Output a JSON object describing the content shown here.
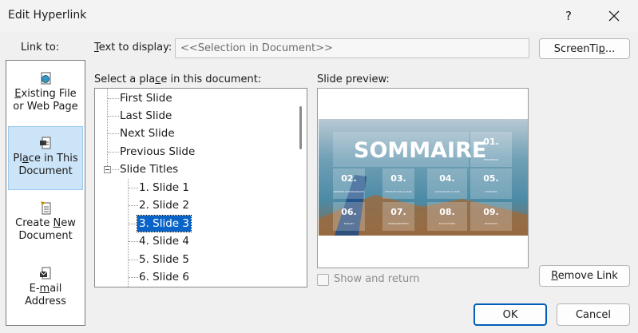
{
  "window": {
    "title": "Edit Hyperlink",
    "help_label": "?"
  },
  "link_to": {
    "label": "Link to:",
    "items": [
      {
        "label_a": "E",
        "label_b": "xisting File",
        "label_c": "or Web Page",
        "icon": "web-page-icon"
      },
      {
        "label_a": "Pl",
        "label_b": "a",
        "label_c": "ce in This",
        "label_d": "Document",
        "icon": "place-in-document-icon"
      },
      {
        "label_a": "Create ",
        "label_b": "N",
        "label_c": "ew",
        "label_d": "Document",
        "icon": "new-document-icon"
      },
      {
        "label_a": "E-",
        "label_b": "m",
        "label_c": "ail",
        "label_d": "Address",
        "icon": "email-address-icon"
      }
    ]
  },
  "text_to_display": {
    "label_u": "T",
    "label_rest": "ext to display:",
    "value": "<<Selection in Document>>"
  },
  "screentip_button": {
    "label_a": "ScreenTi",
    "label_b": "p",
    "label_c": "..."
  },
  "place_section": {
    "label_a": "Select a pla",
    "label_b": "c",
    "label_c": "e in this document:",
    "tree": [
      {
        "label": "First Slide"
      },
      {
        "label": "Last Slide"
      },
      {
        "label": "Next Slide"
      },
      {
        "label": "Previous Slide"
      },
      {
        "label": "Slide Titles"
      },
      {
        "label": "1. Slide 1"
      },
      {
        "label": "2. Slide 2"
      },
      {
        "label": "3. Slide 3",
        "selected": true
      },
      {
        "label": "4. Slide 4"
      },
      {
        "label": "5. Slide 5"
      },
      {
        "label": "6. Slide 6"
      }
    ]
  },
  "preview": {
    "label": "Slide preview:",
    "slide": {
      "title": "SOMMAIRE",
      "tiles": [
        {
          "num": "01.",
          "caption": "ENTREPRISE"
        },
        {
          "num": "02.",
          "caption": "NOMBRE D'ENSEIGNANTS"
        },
        {
          "num": "03.",
          "caption": "EFFECTIF PAR CLASSE"
        },
        {
          "num": "04.",
          "caption": "GESTION DE CLASSE"
        },
        {
          "num": "05.",
          "caption": "HORAIRES"
        },
        {
          "num": "06.",
          "caption": "BUDGET"
        },
        {
          "num": "07.",
          "caption": "ENSEIGNEMENTS"
        },
        {
          "num": "08.",
          "caption": "EVALUATIONS"
        },
        {
          "num": "09.",
          "caption": "RESULTATS"
        }
      ]
    }
  },
  "show_and_return": {
    "label": "Show and return",
    "checked": false
  },
  "remove_link_button": {
    "label_u": "R",
    "label_rest": "emove Link"
  },
  "ok_button": {
    "label": "OK"
  },
  "cancel_button": {
    "label": "Cancel"
  },
  "colors": {
    "accent": "#005fb8",
    "selection": "#0a64c8",
    "selected_item_bg": "#cce4f7"
  }
}
